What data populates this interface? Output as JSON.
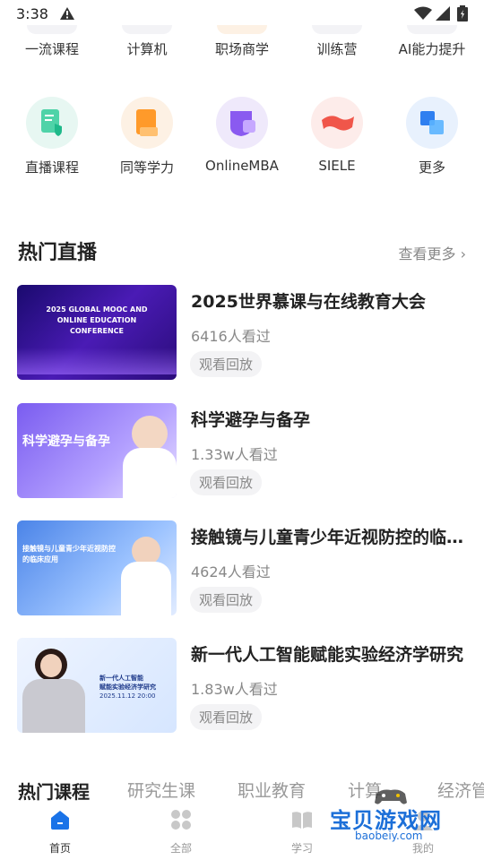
{
  "status": {
    "time": "3:38"
  },
  "top_row": [
    {
      "label": "一流课程"
    },
    {
      "label": "计算机"
    },
    {
      "label": "职场商学"
    },
    {
      "label": "训练营"
    },
    {
      "label": "AI能力提升"
    }
  ],
  "icon_row": [
    {
      "label": "直播课程",
      "icon": "live-course-icon",
      "bg": "#e7f7f2"
    },
    {
      "label": "同等学力",
      "icon": "equivalent-degree-icon",
      "bg": "#fdf1e4"
    },
    {
      "label": "OnlineMBA",
      "icon": "online-mba-icon",
      "bg": "#efe9fb"
    },
    {
      "label": "SIELE",
      "icon": "siele-icon",
      "bg": "#fdecea"
    },
    {
      "label": "更多",
      "icon": "more-icon",
      "bg": "#e8f1fd"
    }
  ],
  "hot_live": {
    "title": "热门直播",
    "more": "查看更多",
    "items": [
      {
        "title": "2025世界慕课与在线教育大会",
        "views": "6416人看过",
        "replay": "观看回放",
        "thumb": {
          "line1": "2025 GLOBAL MOOC AND",
          "line2": "ONLINE EDUCATION CONFERENCE"
        }
      },
      {
        "title": "科学避孕与备孕",
        "views": "1.33w人看过",
        "replay": "观看回放",
        "thumb": {
          "line1": "科学避孕与备孕"
        }
      },
      {
        "title": "接触镜与儿童青少年近视防控的临床应用",
        "views": "4624人看过",
        "replay": "观看回放",
        "thumb": {
          "line1": "接触镜与儿童青少年近视防控",
          "line2": "的临床应用"
        }
      },
      {
        "title": "新一代人工智能赋能实验经济学研究",
        "views": "1.83w人看过",
        "replay": "观看回放",
        "thumb": {
          "line1": "新一代人工智能",
          "line2": "赋能实验经济学研究",
          "line3": "2025.11.12 20:00"
        }
      }
    ]
  },
  "course_tabs": [
    {
      "label": "热门课程",
      "active": true
    },
    {
      "label": "研究生课"
    },
    {
      "label": "职业教育"
    },
    {
      "label": "计算"
    },
    {
      "label": "经济管"
    }
  ],
  "bottom_nav": [
    {
      "label": "首页",
      "icon": "home-icon",
      "active": true
    },
    {
      "label": "全部",
      "icon": "grid-icon"
    },
    {
      "label": "学习",
      "icon": "book-icon"
    },
    {
      "label": "我的",
      "icon": "profile-icon"
    }
  ],
  "watermark": {
    "title": "宝贝游戏网",
    "url": "baobeiy.com"
  },
  "colors": {
    "accent": "#1a73e8",
    "muted": "#888888"
  }
}
